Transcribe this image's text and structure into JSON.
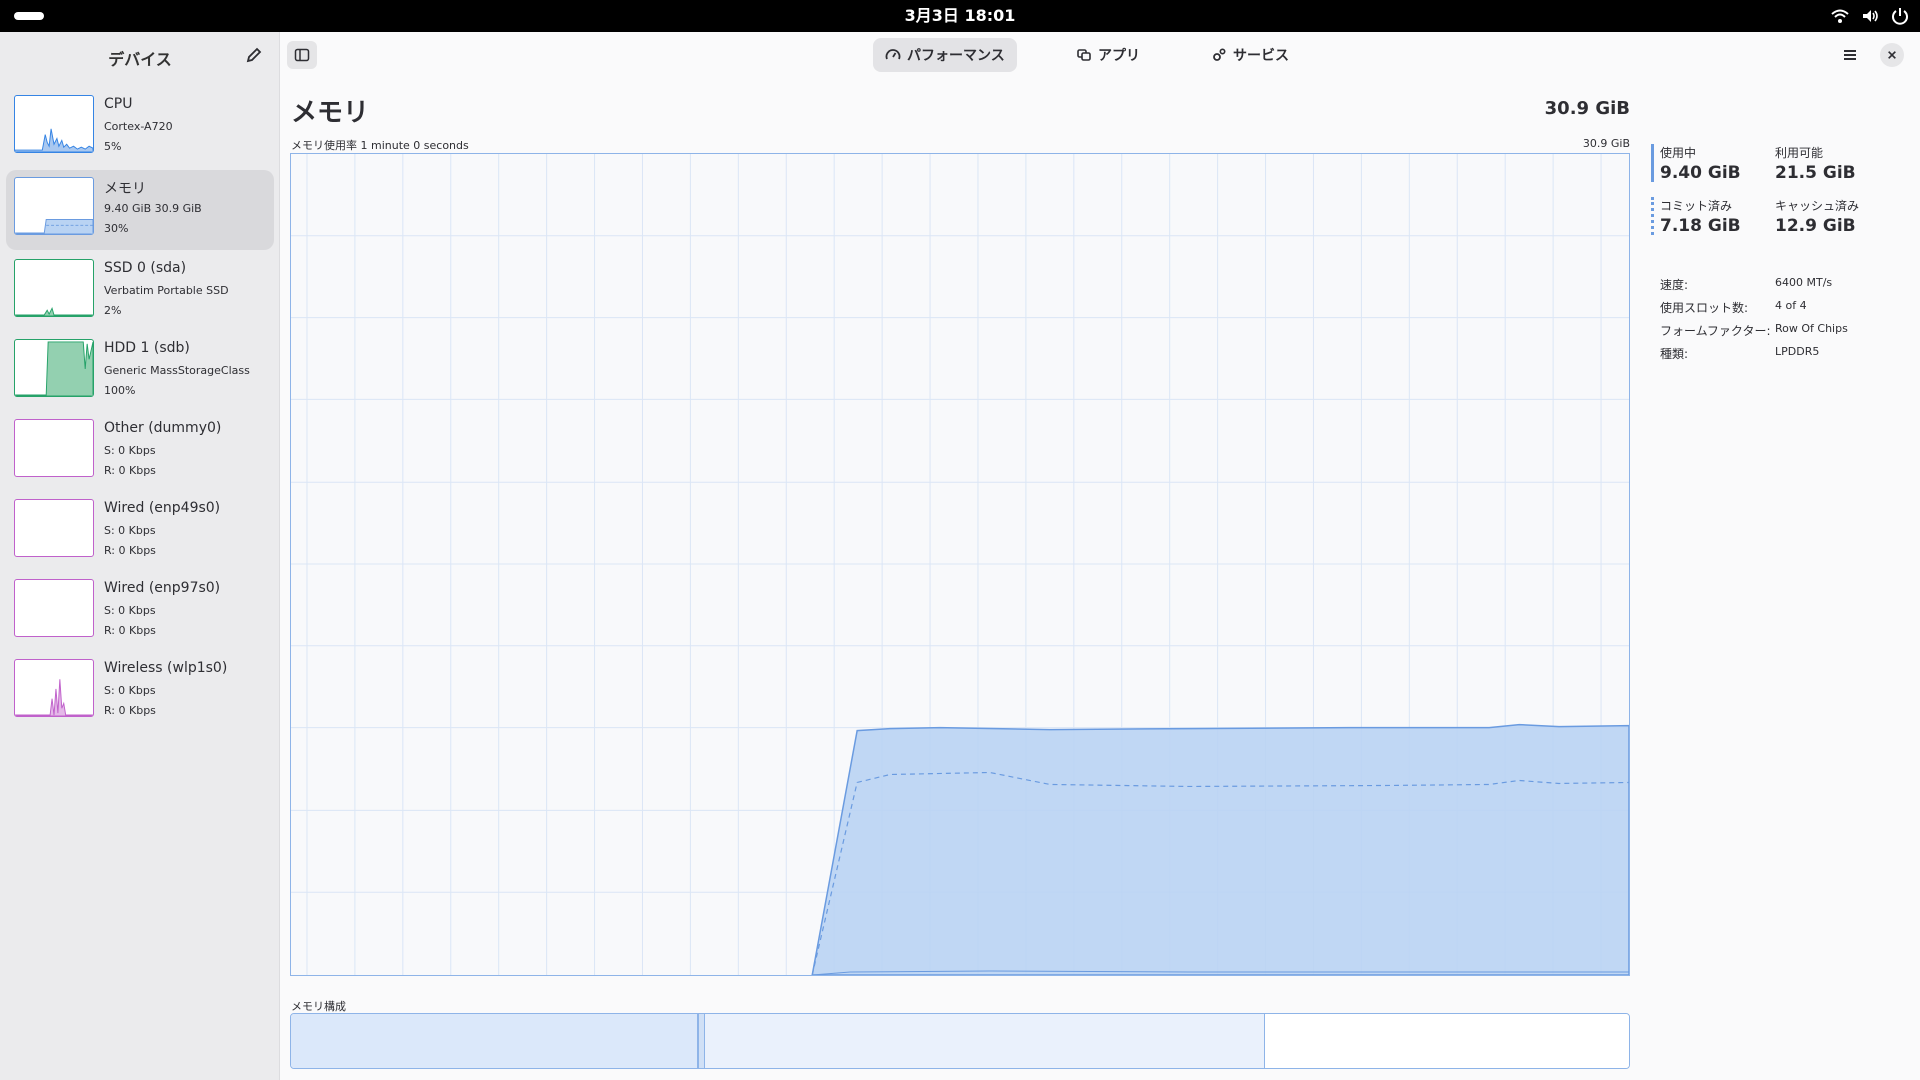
{
  "topbar": {
    "clock": "3月3日  18:01"
  },
  "sidebar": {
    "title": "デバイス",
    "devices": [
      {
        "name": "CPU",
        "line1": "Cortex-A720",
        "line2": "5%",
        "color": "#3584e4",
        "selected": false
      },
      {
        "name": "メモリ",
        "line1": "9.40 GiB 30.9 GiB",
        "line2": "30%",
        "color": "#6a9be0",
        "selected": true
      },
      {
        "name": "SSD 0 (sda)",
        "line1": "Verbatim Portable SSD",
        "line2": "2%",
        "color": "#26a269",
        "selected": false
      },
      {
        "name": "HDD 1 (sdb)",
        "line1": "Generic MassStorageClass",
        "line2": "100%",
        "color": "#26a269",
        "selected": false
      },
      {
        "name": "Other (dummy0)",
        "line1": "S: 0 Kbps",
        "line2": "R: 0 Kbps",
        "color": "#c061cb",
        "selected": false
      },
      {
        "name": "Wired (enp49s0)",
        "line1": "S: 0 Kbps",
        "line2": "R: 0 Kbps",
        "color": "#c061cb",
        "selected": false
      },
      {
        "name": "Wired (enp97s0)",
        "line1": "S: 0 Kbps",
        "line2": "R: 0 Kbps",
        "color": "#c061cb",
        "selected": false
      },
      {
        "name": "Wireless (wlp1s0)",
        "line1": "S: 0 Kbps",
        "line2": "R: 0 Kbps",
        "color": "#c061cb",
        "selected": false
      }
    ]
  },
  "header": {
    "tabs": [
      {
        "label": "パフォーマンス",
        "icon": "gauge-icon",
        "active": true
      },
      {
        "label": "アプリ",
        "icon": "apps-icon",
        "active": false
      },
      {
        "label": "サービス",
        "icon": "gears-icon",
        "active": false
      }
    ]
  },
  "main": {
    "title": "メモリ",
    "total": "30.9 GiB",
    "graph_caption": "メモリ使用率 1 minute 0 seconds",
    "graph_max_label": "30.9 GiB",
    "composition_caption": "メモリ構成"
  },
  "stats": {
    "used": {
      "label": "使用中",
      "value": "9.40 GiB"
    },
    "available": {
      "label": "利用可能",
      "value": "21.5 GiB"
    },
    "committed": {
      "label": "コミット済み",
      "value": "7.18 GiB"
    },
    "cached": {
      "label": "キャッシュ済み",
      "value": "12.9 GiB"
    }
  },
  "properties": [
    {
      "label": "速度:",
      "value": "6400 MT/s"
    },
    {
      "label": "使用スロット数:",
      "value": "4 of 4"
    },
    {
      "label": "フォームファクター:",
      "value": "Row Of Chips"
    },
    {
      "label": "種類:",
      "value": "LPDDR5"
    }
  ],
  "colors": {
    "accent": "#3584e4",
    "memory_fill": "#b9d3f3",
    "memory_line": "#6a9be0"
  }
}
